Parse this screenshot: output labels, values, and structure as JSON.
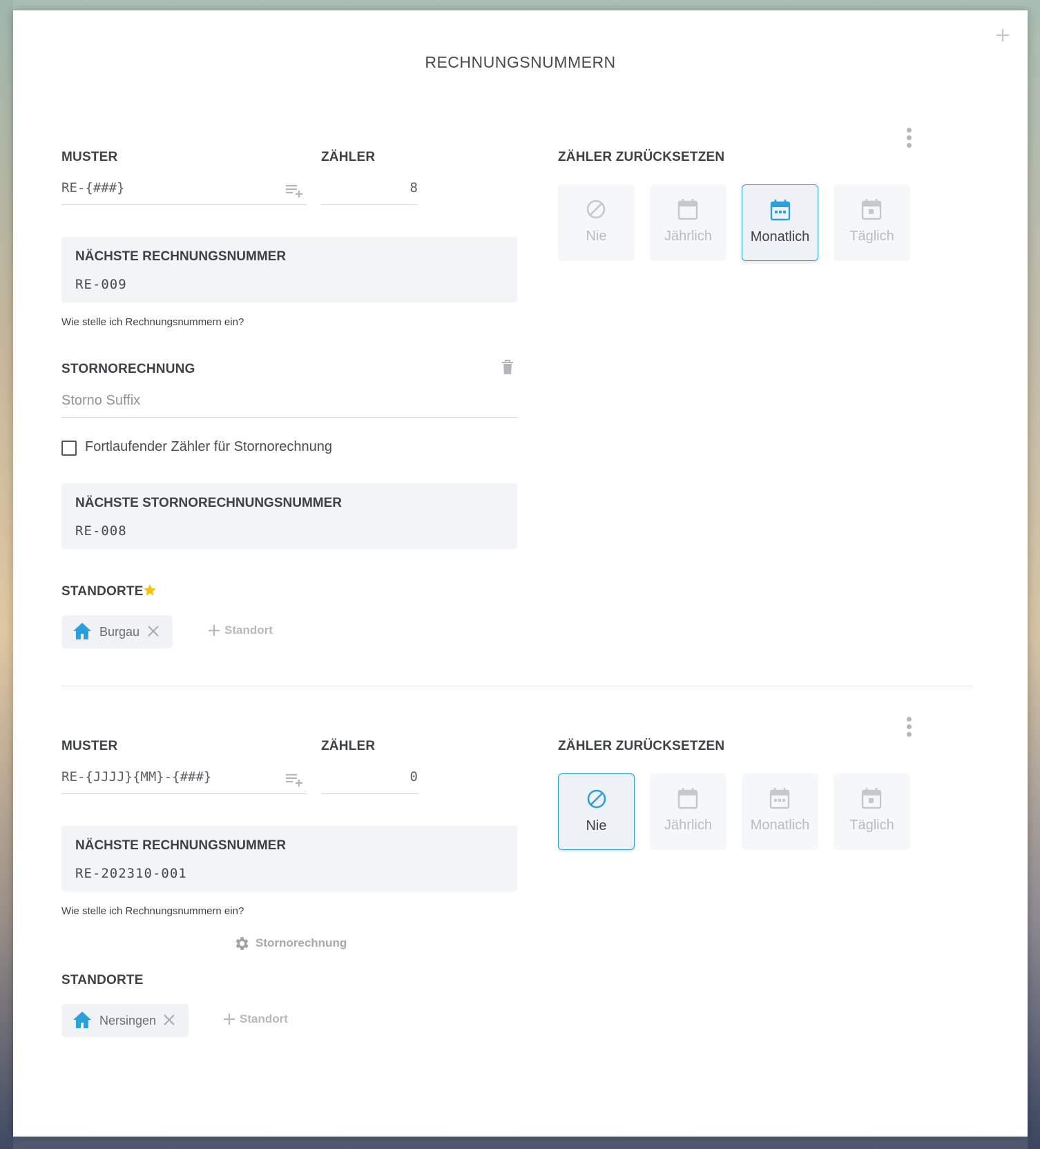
{
  "title": "RECHNUNGSNUMMERN",
  "colors": {
    "accent": "#2aa0dc",
    "star": "#f5c400",
    "muted": "#b8bbbf"
  },
  "sections": [
    {
      "muster_label": "MUSTER",
      "muster_value": "RE-{###}",
      "zaehler_label": "ZÄHLER",
      "zaehler_value": "8",
      "reset_label": "ZÄHLER ZURÜCKSETZEN",
      "reset_options": [
        "Nie",
        "Jährlich",
        "Monatlich",
        "Täglich"
      ],
      "reset_selected": "Monatlich",
      "next_label": "NÄCHSTE RECHNUNGSNUMMER",
      "next_value": "RE-009",
      "help_text": "Wie stelle ich Rechnungsnummern ein?",
      "storno": {
        "label": "STORNORECHNUNG",
        "suffix_placeholder": "Storno Suffix",
        "checkbox_label": "Fortlaufender Zähler für Stornorechnung",
        "checkbox_checked": false,
        "next_label": "NÄCHSTE STORNORECHNUNGSNUMMER",
        "next_value": "RE-008"
      },
      "standorte_label": "STANDORTE",
      "standorte_starred": true,
      "locations": [
        "Burgau"
      ],
      "add_location_label": "Standort"
    },
    {
      "muster_label": "MUSTER",
      "muster_value": "RE-{JJJJ}{MM}-{###}",
      "zaehler_label": "ZÄHLER",
      "zaehler_value": "0",
      "reset_label": "ZÄHLER ZURÜCKSETZEN",
      "reset_options": [
        "Nie",
        "Jährlich",
        "Monatlich",
        "Täglich"
      ],
      "reset_selected": "Nie",
      "next_label": "NÄCHSTE RECHNUNGSNUMMER",
      "next_value": "RE-202310-001",
      "help_text": "Wie stelle ich Rechnungsnummern ein?",
      "storno_button_label": "Stornorechnung",
      "standorte_label": "STANDORTE",
      "standorte_starred": false,
      "locations": [
        "Nersingen"
      ],
      "add_location_label": "Standort"
    }
  ],
  "icons": {
    "add": "plus-icon",
    "more": "kebab-menu-icon",
    "pattern_insert": "playlist-add-icon",
    "delete": "trash-icon",
    "nie": "block-icon",
    "jaehrlich": "calendar-blank-icon",
    "monatlich": "calendar-month-icon",
    "taeglich": "calendar-today-icon",
    "location": "home-icon",
    "remove": "close-icon",
    "settings": "gear-icon",
    "favorite": "star-icon"
  }
}
